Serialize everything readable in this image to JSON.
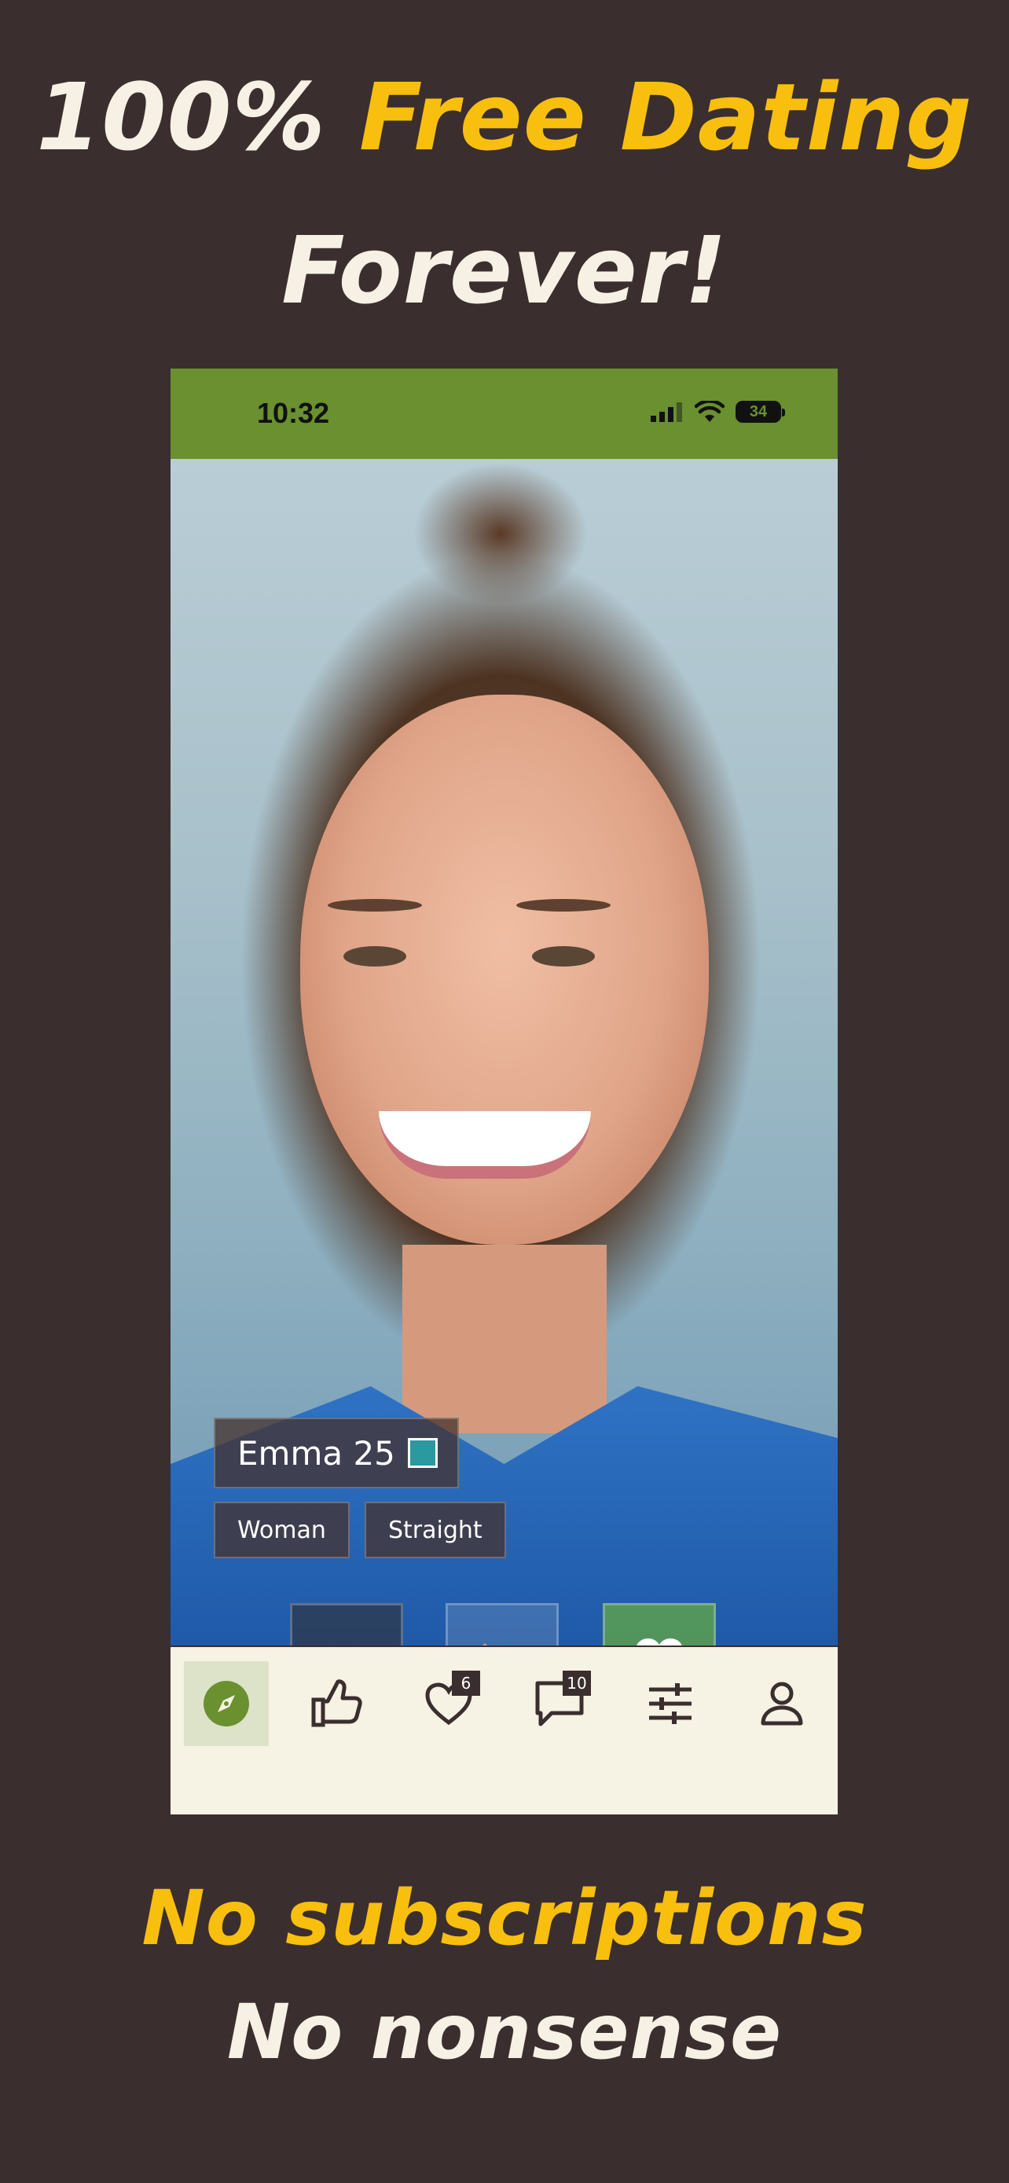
{
  "promo": {
    "headline_part1": "100% ",
    "headline_part2": "Free Dating",
    "headline_line2": "Forever!",
    "footer_line1": "No subscriptions",
    "footer_line2": "No nonsense"
  },
  "status_bar": {
    "time": "10:32",
    "battery": "34"
  },
  "profile": {
    "name_age": "Emma 25",
    "tags": [
      "Woman",
      "Straight"
    ]
  },
  "actions": {
    "reject_icon": "close-icon",
    "undo_icon": "undo-icon",
    "like_icon": "heart-icon"
  },
  "nav": {
    "items": [
      {
        "icon": "compass-icon",
        "badge": ""
      },
      {
        "icon": "thumbs-up-icon",
        "badge": ""
      },
      {
        "icon": "heart-outline-icon",
        "badge": "6"
      },
      {
        "icon": "chat-icon",
        "badge": "10"
      },
      {
        "icon": "sliders-icon",
        "badge": ""
      },
      {
        "icon": "profile-icon",
        "badge": ""
      }
    ]
  },
  "colors": {
    "background": "#3a2e2e",
    "accent_gold": "#f8bf0f",
    "cream": "#f6f1e4",
    "status_green": "#6a9030"
  }
}
